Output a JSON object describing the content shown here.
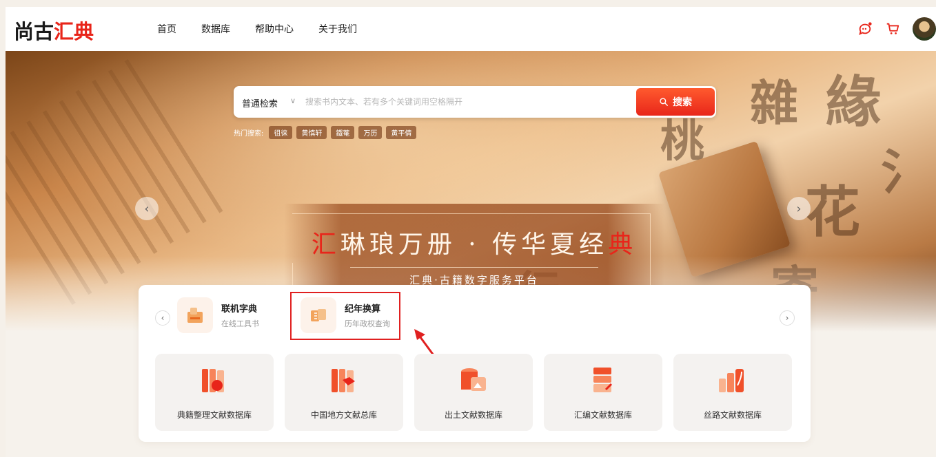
{
  "brand": {
    "logo_text_dark": "尚古",
    "logo_text_red": "汇典"
  },
  "nav": {
    "items": [
      "首页",
      "数据库",
      "帮助中心",
      "关于我们"
    ]
  },
  "header_icons": {
    "message": "message-icon",
    "cart": "cart-icon",
    "avatar": "avatar"
  },
  "search": {
    "mode": "普通检索",
    "placeholder": "搜索书内文本、若有多个关键词用空格隔开",
    "button": "搜索",
    "hot_label": "热门搜索:",
    "hot_tags": [
      "徂徕",
      "黄慎轩",
      "鐵菴",
      "万历",
      "黄平倩"
    ]
  },
  "banner": {
    "title_red_start": "汇",
    "title_mid": "琳琅万册 · 传华夏经",
    "title_red_end": "典",
    "subtitle": "汇典·古籍数字服务平台"
  },
  "tools": [
    {
      "name": "联机字典",
      "desc": "在线工具书"
    },
    {
      "name": "纪年换算",
      "desc": "历年政权查询"
    }
  ],
  "databases": [
    {
      "label": "典籍整理文献数据库",
      "icon": "books-icon"
    },
    {
      "label": "中国地方文献总库",
      "icon": "stacked-books-icon"
    },
    {
      "label": "出土文献数据库",
      "icon": "database-image-icon"
    },
    {
      "label": "汇编文献数据库",
      "icon": "compiled-docs-icon"
    },
    {
      "label": "丝路文献数据库",
      "icon": "silk-road-books-icon"
    }
  ],
  "colors": {
    "brand_red": "#e8251a",
    "accent_orange": "#ff5a2e",
    "highlight_box": "#e02020"
  }
}
